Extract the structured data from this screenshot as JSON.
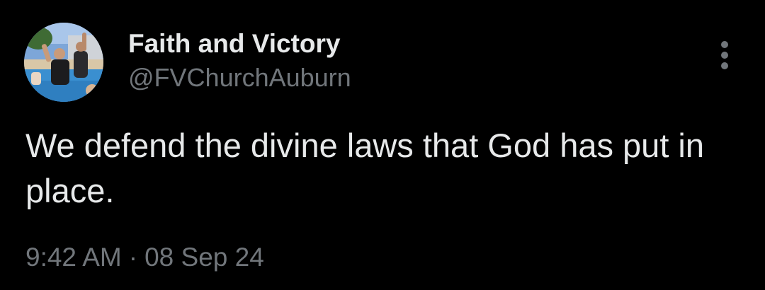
{
  "tweet": {
    "author": {
      "display_name": "Faith and Victory",
      "handle": "@FVChurchAuburn",
      "avatar_icon": "profile-photo-baptism-pool"
    },
    "more_icon": "more-vertical-icon",
    "text": "We defend the divine laws that God has put in place.",
    "time": "9:42 AM",
    "separator": "·",
    "date": "08 Sep 24"
  },
  "colors": {
    "background": "#000000",
    "primary_text": "#e7e9ea",
    "secondary_text": "#71767b"
  }
}
